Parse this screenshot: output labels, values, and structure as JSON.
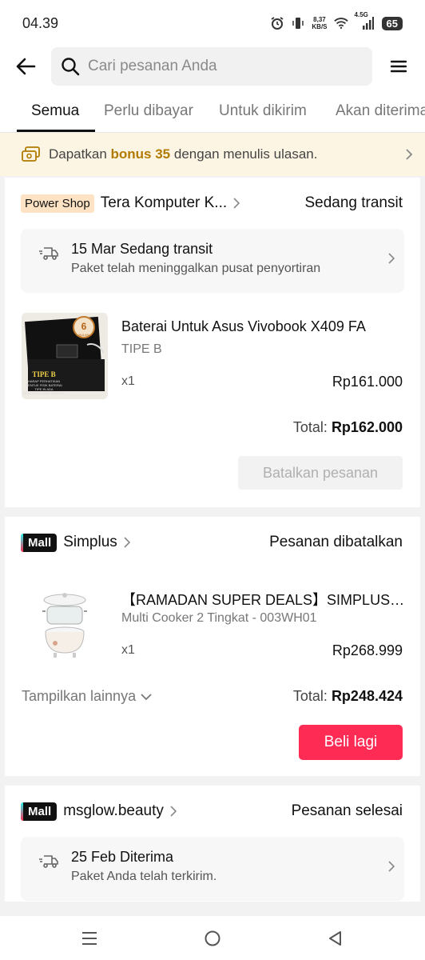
{
  "status_bar": {
    "time": "04.39",
    "net_speed_value": "8,37",
    "net_speed_unit": "KB/S",
    "signal": "4.5G",
    "battery": "65"
  },
  "search": {
    "placeholder": "Cari pesanan Anda"
  },
  "tabs": [
    {
      "label": "Semua",
      "active": true
    },
    {
      "label": "Perlu dibayar"
    },
    {
      "label": "Untuk dikirim"
    },
    {
      "label": "Akan diterima"
    }
  ],
  "banner": {
    "text_before": "Dapatkan",
    "bonus": "bonus 35",
    "text_after": "dengan menulis ulasan."
  },
  "orders": [
    {
      "badge": "Power Shop",
      "shop": "Tera Komputer K...",
      "status": "Sedang transit",
      "tracking": {
        "title": "15 Mar Sedang transit",
        "subtitle": "Paket telah meninggalkan pusat penyortiran"
      },
      "product": {
        "name": "Baterai Untuk Asus Vivobook X409 FA",
        "variant": "TIPE B",
        "qty": "x1",
        "price": "Rp161.000",
        "image_text": {
          "type": "TIPE B",
          "note1": "HARAP PERHATIKAN",
          "note2": "BENTUK FISIK BATERAI",
          "note3": "TIPE IN ADA",
          "note4": "BEBERAPA JENIS BATERAI",
          "months": "6",
          "bulan": "BULAN"
        }
      },
      "total_label": "Total:",
      "total": "Rp162.000",
      "action": "Batalkan pesanan"
    },
    {
      "badge": "Mall",
      "shop": "Simplus",
      "status": "Pesanan dibatalkan",
      "product": {
        "name": "【RAMADAN SUPER DEALS】SIMPLUS Multi Cooker",
        "variant": "Multi Cooker 2 Tingkat - 003WH01",
        "qty": "x1",
        "price": "Rp268.999"
      },
      "show_more": "Tampilkan lainnya",
      "total_label": "Total:",
      "total": "Rp248.424",
      "action": "Beli lagi"
    },
    {
      "badge": "Mall",
      "shop": "msglow.beauty",
      "status": "Pesanan selesai",
      "tracking": {
        "title": "25 Feb Diterima",
        "subtitle": "Paket Anda telah terkirim."
      }
    }
  ],
  "colors": {
    "accent": "#fe2c55",
    "bonus": "#b17a00",
    "banner_bg": "#fdf5e4",
    "power_shop_bg": "#fde3c4"
  },
  "icons": [
    "back-arrow-icon",
    "search-icon",
    "hamburger-menu-icon",
    "coupon-icon",
    "truck-icon",
    "chevron-right-icon",
    "chevron-down-icon",
    "recents-icon",
    "home-icon",
    "back-triangle-icon"
  ]
}
